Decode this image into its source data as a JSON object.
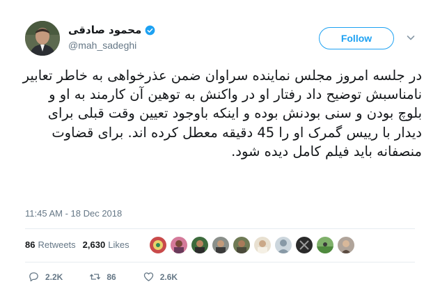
{
  "author": {
    "name": "محمود صادقی",
    "handle": "@mah_sadeghi",
    "verified": true
  },
  "follow_label": "Follow",
  "tweet": {
    "text": "در جلسه امروز مجلس نماینده سراوان ضمن عذرخواهی به خاطر تعابیر نامناسبش توضیح داد رفتار او در واکنش به توهین آن کارمند به او و بلوچ بودن و سنی بودنش بوده و اینکه باوجود تعیین وقت قبلی برای دیدار با رییس گمرک او را 45 دقیقه معطل کرده اند. برای قضاوت منصفانه باید فیلم کامل دیده شود.",
    "timestamp": "11:45 AM - 18 Dec 2018"
  },
  "stats": {
    "retweets_count": "86",
    "retweets_label": "Retweets",
    "likes_count": "2,630",
    "likes_label": "Likes"
  },
  "actions": {
    "reply_count": "2.2K",
    "retweet_count": "86",
    "like_count": "2.6K"
  },
  "colors": {
    "accent": "#1da1f2",
    "text": "#14171a",
    "secondary": "#657786"
  },
  "icons": {
    "verified": "verified-badge-icon",
    "chevron": "chevron-down-icon",
    "reply": "reply-icon",
    "retweet": "retweet-icon",
    "like": "heart-icon"
  }
}
